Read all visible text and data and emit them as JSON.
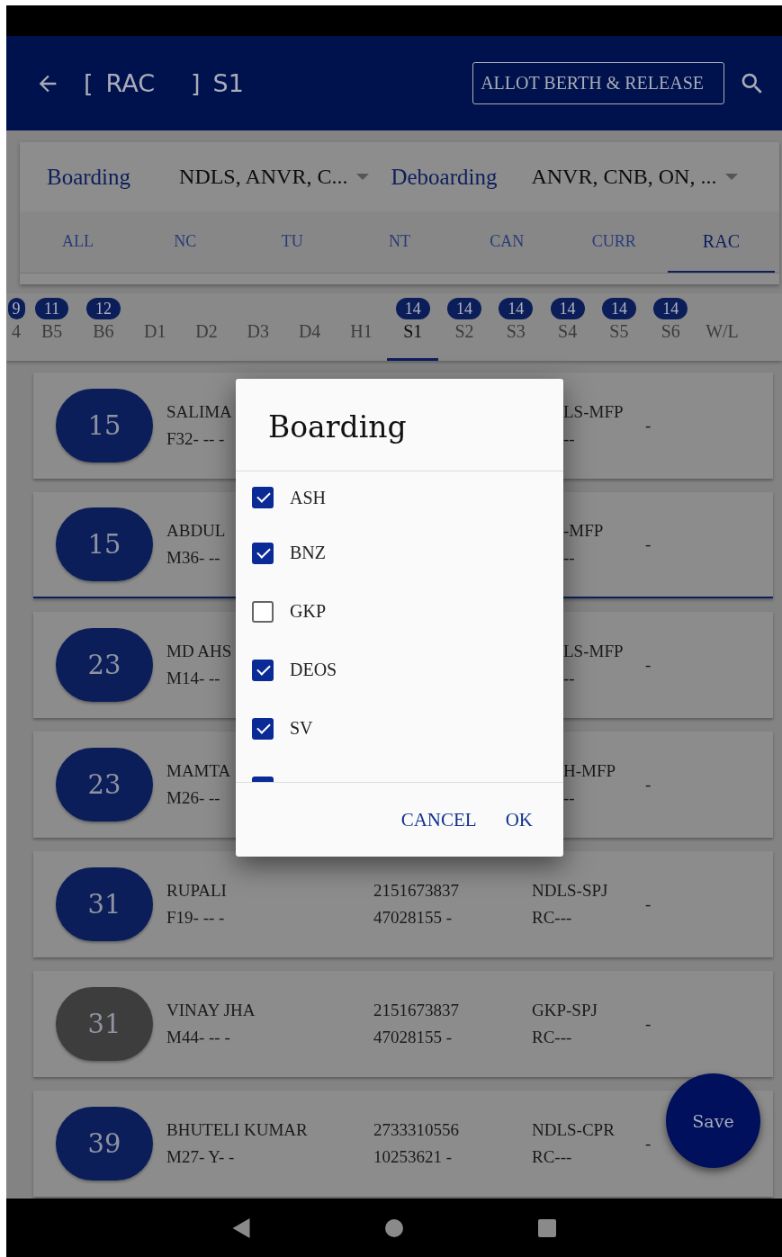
{
  "app_bar": {
    "bracket_open": "[",
    "quota": "RAC",
    "bracket_close": "]",
    "coach": "S1",
    "action": "ALLOT BERTH & RELEASE"
  },
  "filters": {
    "boarding": {
      "label": "Boarding",
      "value": "NDLS, ANVR, C..."
    },
    "deboarding": {
      "label": "Deboarding",
      "value": "ANVR, CNB, ON, ..."
    },
    "tabs": [
      {
        "label": "ALL",
        "selected": false
      },
      {
        "label": "NC",
        "selected": false
      },
      {
        "label": "TU",
        "selected": false
      },
      {
        "label": "NT",
        "selected": false
      },
      {
        "label": "CAN",
        "selected": false
      },
      {
        "label": "CURR",
        "selected": false
      },
      {
        "label": "RAC",
        "selected": true
      }
    ]
  },
  "coaches": [
    {
      "label": "4",
      "badge": "9",
      "selected": false
    },
    {
      "label": "B5",
      "badge": "11",
      "selected": false
    },
    {
      "label": "B6",
      "badge": "12",
      "selected": false
    },
    {
      "label": "D1",
      "selected": false
    },
    {
      "label": "D2",
      "selected": false
    },
    {
      "label": "D3",
      "selected": false
    },
    {
      "label": "D4",
      "selected": false
    },
    {
      "label": "H1",
      "selected": false
    },
    {
      "label": "S1",
      "badge": "14",
      "selected": true
    },
    {
      "label": "S2",
      "badge": "14",
      "selected": false
    },
    {
      "label": "S3",
      "badge": "14",
      "selected": false
    },
    {
      "label": "S4",
      "badge": "14",
      "selected": false
    },
    {
      "label": "S5",
      "badge": "14",
      "selected": false
    },
    {
      "label": "S6",
      "badge": "14",
      "selected": false
    },
    {
      "label": "W/L",
      "selected": false
    }
  ],
  "passengers": [
    {
      "kind": "covered",
      "berth": "15",
      "color": "#0b1e5a",
      "name": "SALIMA",
      "details": "F32- -- -",
      "route": "LS-MFP",
      "status": "--",
      "remark": "-",
      "selected": false
    },
    {
      "kind": "covered",
      "berth": "15",
      "color": "#0b1e5a",
      "name": "ABDUL",
      "details": "M36- --",
      "route": "-MFP",
      "status": "--",
      "remark": "-",
      "selected": true
    },
    {
      "kind": "covered",
      "berth": "23",
      "color": "#0b1e5a",
      "name": "MD AHS",
      "details": "M14- --",
      "route": "LS-MFP",
      "status": "--",
      "remark": "-",
      "selected": false
    },
    {
      "kind": "covered",
      "berth": "23",
      "color": "#0b1e5a",
      "name": "MAMTA",
      "details": "M26- --",
      "route": "H-MFP",
      "status": "--",
      "remark": "-",
      "selected": false
    },
    {
      "kind": "full",
      "berth": "31",
      "color": "#0b1e5a",
      "name": "RUPALI",
      "details": "F19- -- -",
      "pnr": "2151673837",
      "ticket": "47028155 -",
      "route": "NDLS-SPJ",
      "status": "RC---",
      "remark": "-",
      "selected": false
    },
    {
      "kind": "full",
      "berth": "31",
      "color": "#3d3d3d",
      "name": "VINAY JHA",
      "details": "M44- -- -",
      "pnr": "2151673837",
      "ticket": "47028155 -",
      "route": "GKP-SPJ",
      "status": "RC---",
      "remark": "-",
      "selected": false
    },
    {
      "kind": "full",
      "berth": "39",
      "color": "#0b1e5a",
      "name": "BHUTELI KUMAR",
      "details": "M27- Y- -",
      "pnr": "2733310556",
      "ticket": "10253621 -",
      "route": "NDLS-CPR",
      "status": "RC---",
      "remark": "-",
      "selected": false
    }
  ],
  "save_button": "Save",
  "dialog": {
    "title": "Boarding",
    "options": [
      {
        "label": "ASH",
        "checked": true
      },
      {
        "label": "BNZ",
        "checked": true
      },
      {
        "label": "GKP",
        "checked": false
      },
      {
        "label": "DEOS",
        "checked": true
      },
      {
        "label": "SV",
        "checked": true
      },
      {
        "checked": true
      }
    ],
    "buttons": [
      "CANCEL",
      "OK"
    ]
  }
}
